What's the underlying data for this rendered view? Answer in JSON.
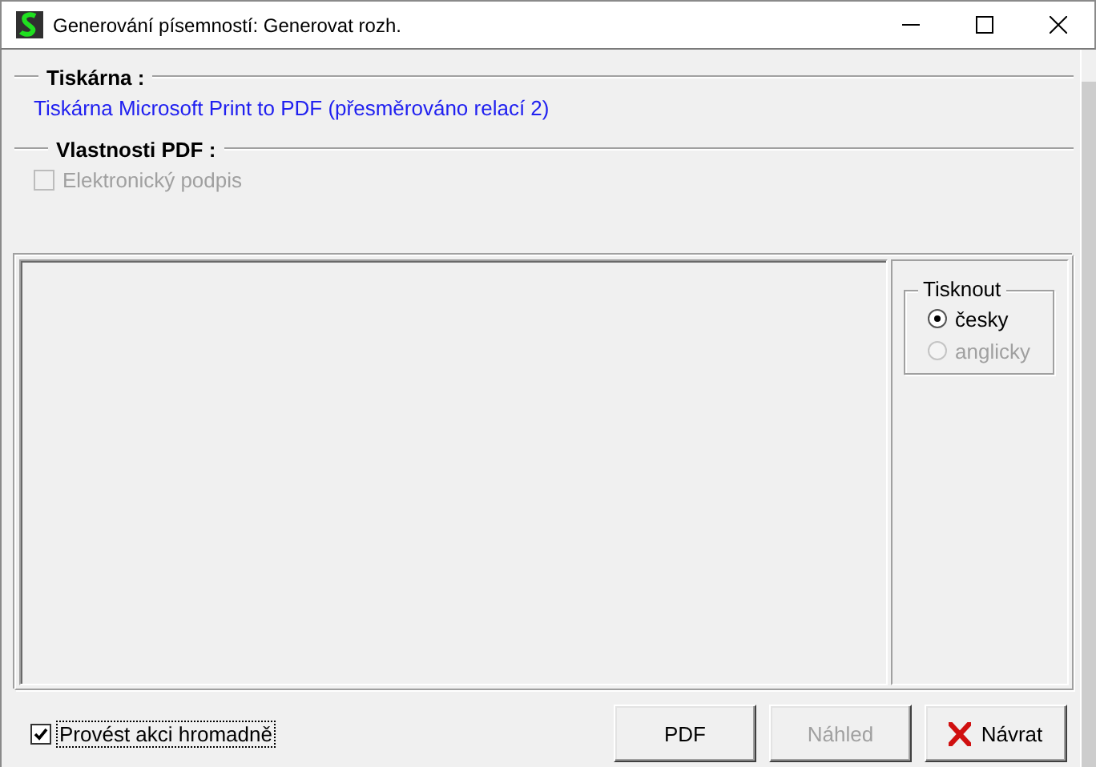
{
  "window": {
    "title": "Generování písemností: Generovat rozh."
  },
  "printer": {
    "heading": "Tiskárna :",
    "name": "Tiskárna Microsoft Print to PDF (přesměrováno relací 2)"
  },
  "pdf_properties": {
    "heading": "Vlastnosti PDF :",
    "options": [
      {
        "label": "Elektronický podpis",
        "checked": false,
        "disabled": true
      }
    ]
  },
  "print_language": {
    "heading": "Tisknout",
    "options": [
      {
        "label": "česky",
        "selected": true,
        "disabled": false
      },
      {
        "label": "anglicky",
        "selected": false,
        "disabled": true
      }
    ]
  },
  "bulk_action": {
    "label": "Provést akci hromadně",
    "checked": true,
    "focused": true
  },
  "buttons": [
    {
      "label": "PDF",
      "kind": "plain",
      "disabled": false
    },
    {
      "label": "Náhled",
      "kind": "plain",
      "disabled": true
    },
    {
      "label": "Návrat",
      "kind": "close",
      "disabled": false
    }
  ]
}
